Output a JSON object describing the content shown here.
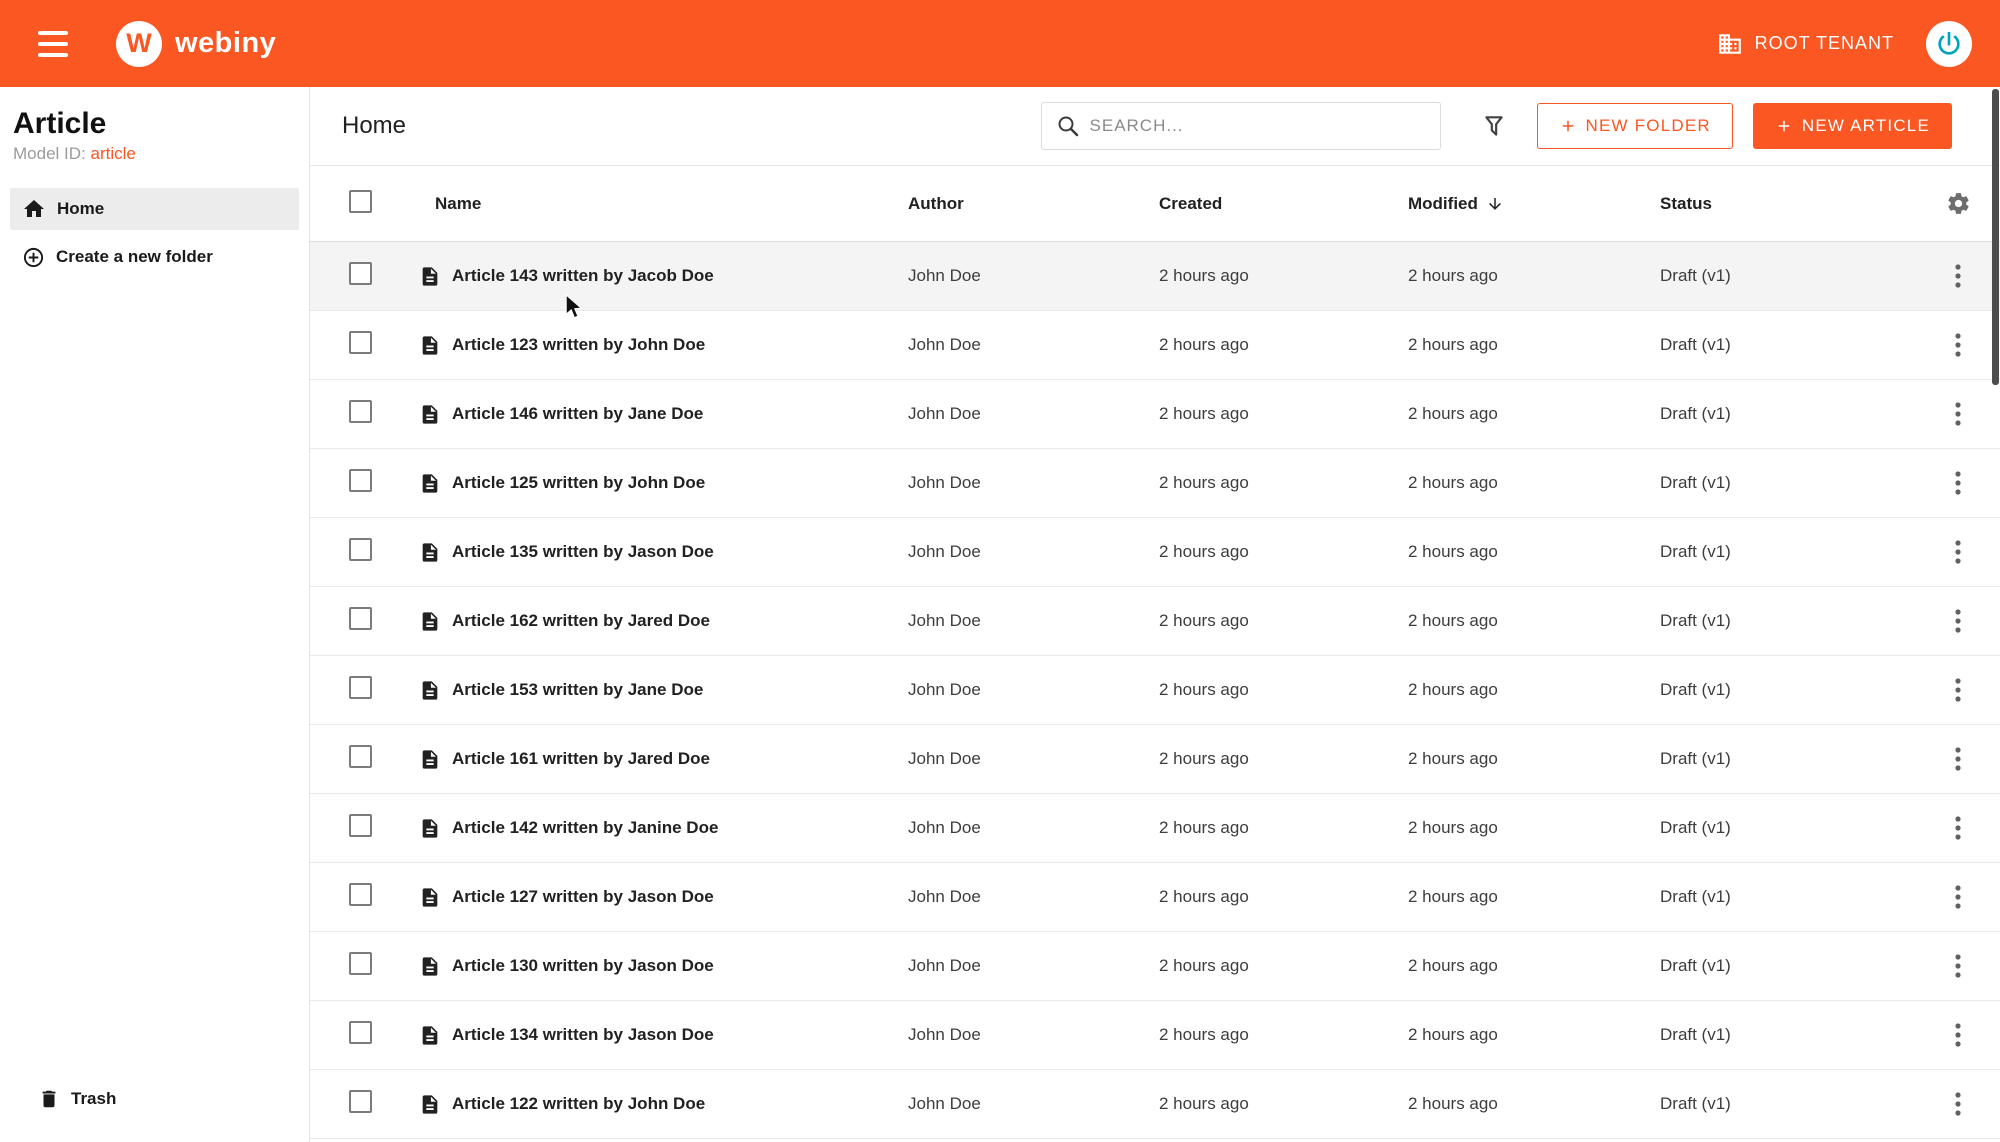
{
  "topbar": {
    "brand": "webiny",
    "logo_letter": "W",
    "tenant_label": "ROOT TENANT"
  },
  "sidebar": {
    "title": "Article",
    "model_id_label": "Model ID:",
    "model_id_value": "article",
    "nav": {
      "home": "Home",
      "create_folder": "Create a new folder"
    },
    "trash": "Trash"
  },
  "main": {
    "breadcrumb": "Home",
    "search_placeholder": "SEARCH...",
    "new_folder_label": "NEW FOLDER",
    "new_article_label": "NEW ARTICLE"
  },
  "table": {
    "columns": {
      "name": "Name",
      "author": "Author",
      "created": "Created",
      "modified": "Modified",
      "status": "Status"
    },
    "rows": [
      {
        "name": "Article 143 written by Jacob Doe",
        "author": "John Doe",
        "created": "2 hours ago",
        "modified": "2 hours ago",
        "status": "Draft (v1)",
        "highlighted": true
      },
      {
        "name": "Article 123 written by John Doe",
        "author": "John Doe",
        "created": "2 hours ago",
        "modified": "2 hours ago",
        "status": "Draft (v1)"
      },
      {
        "name": "Article 146 written by Jane Doe",
        "author": "John Doe",
        "created": "2 hours ago",
        "modified": "2 hours ago",
        "status": "Draft (v1)"
      },
      {
        "name": "Article 125 written by John Doe",
        "author": "John Doe",
        "created": "2 hours ago",
        "modified": "2 hours ago",
        "status": "Draft (v1)"
      },
      {
        "name": "Article 135 written by Jason Doe",
        "author": "John Doe",
        "created": "2 hours ago",
        "modified": "2 hours ago",
        "status": "Draft (v1)"
      },
      {
        "name": "Article 162 written by Jared Doe",
        "author": "John Doe",
        "created": "2 hours ago",
        "modified": "2 hours ago",
        "status": "Draft (v1)"
      },
      {
        "name": "Article 153 written by Jane Doe",
        "author": "John Doe",
        "created": "2 hours ago",
        "modified": "2 hours ago",
        "status": "Draft (v1)"
      },
      {
        "name": "Article 161 written by Jared Doe",
        "author": "John Doe",
        "created": "2 hours ago",
        "modified": "2 hours ago",
        "status": "Draft (v1)"
      },
      {
        "name": "Article 142 written by Janine Doe",
        "author": "John Doe",
        "created": "2 hours ago",
        "modified": "2 hours ago",
        "status": "Draft (v1)"
      },
      {
        "name": "Article 127 written by Jason Doe",
        "author": "John Doe",
        "created": "2 hours ago",
        "modified": "2 hours ago",
        "status": "Draft (v1)"
      },
      {
        "name": "Article 130 written by Jason Doe",
        "author": "John Doe",
        "created": "2 hours ago",
        "modified": "2 hours ago",
        "status": "Draft (v1)"
      },
      {
        "name": "Article 134 written by Jason Doe",
        "author": "John Doe",
        "created": "2 hours ago",
        "modified": "2 hours ago",
        "status": "Draft (v1)"
      },
      {
        "name": "Article 122 written by John Doe",
        "author": "John Doe",
        "created": "2 hours ago",
        "modified": "2 hours ago",
        "status": "Draft (v1)"
      }
    ]
  },
  "colors": {
    "primary": "#fa5723",
    "topbar_bg": "#fa5723",
    "row_highlight": "#f4f4f4",
    "avatar_glyph": "#00a3c4"
  }
}
